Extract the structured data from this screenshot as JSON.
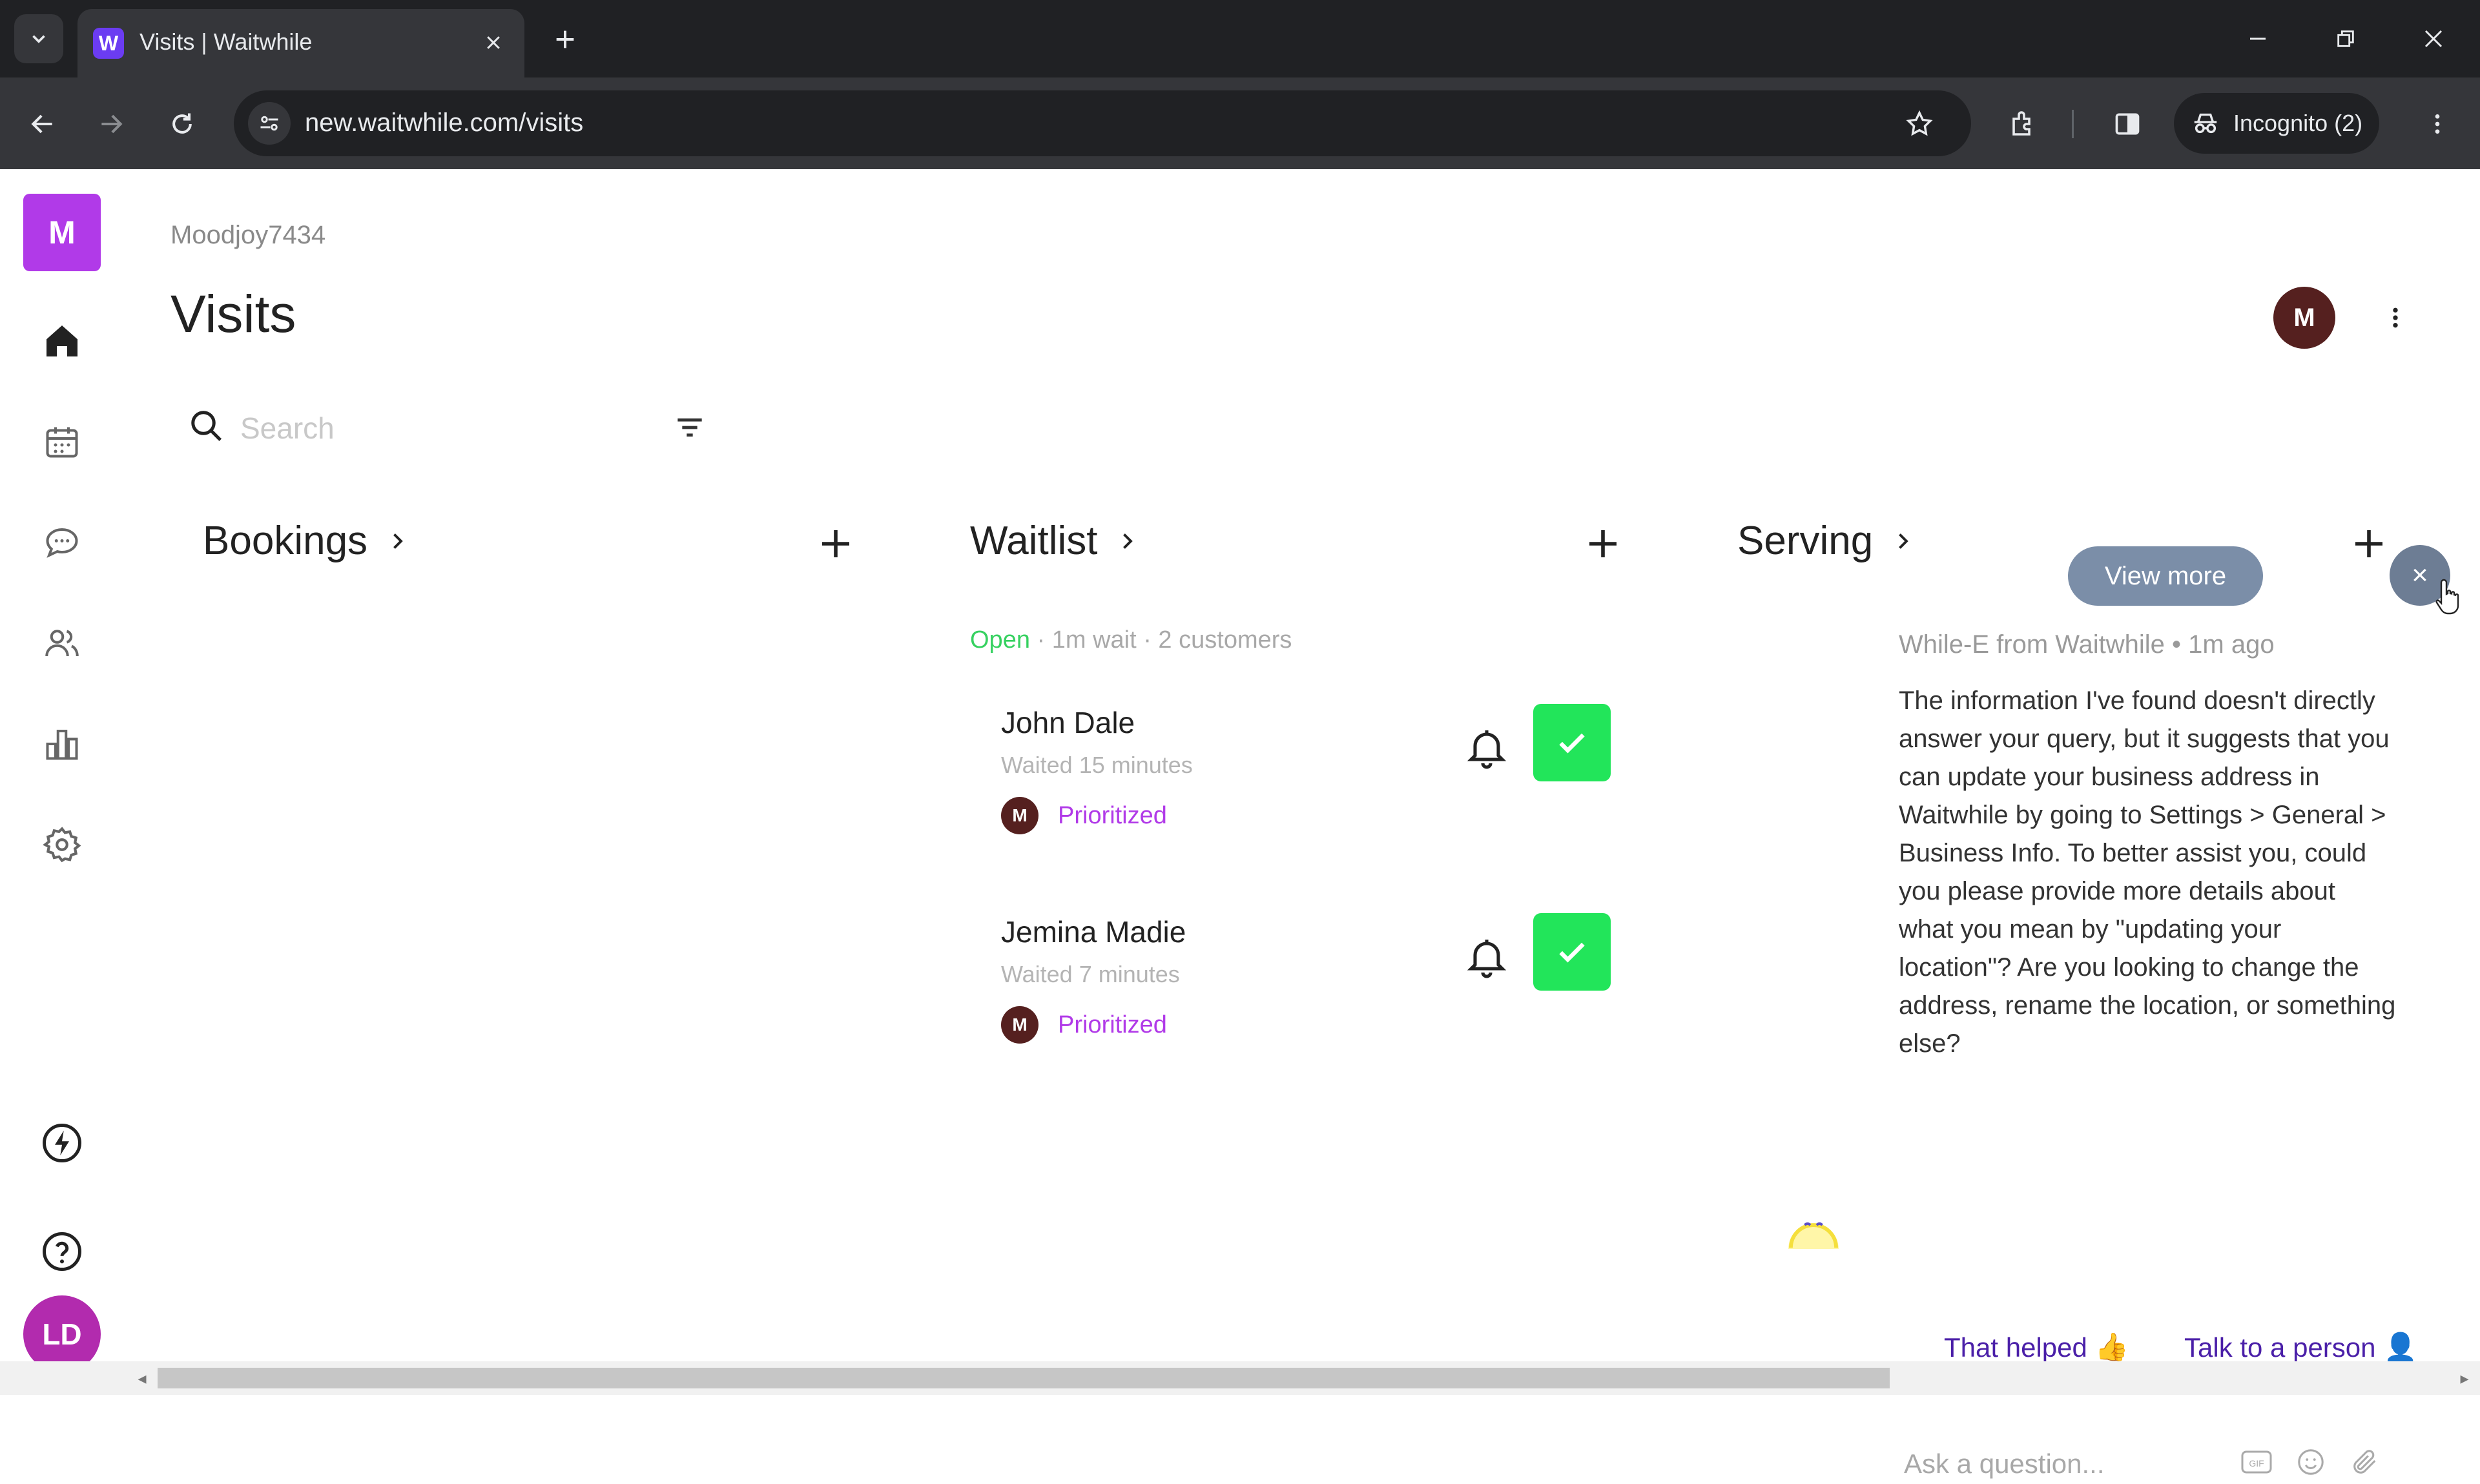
{
  "browser": {
    "tab_title": "Visits | Waitwhile",
    "tab_favicon": "W",
    "url": "new.waitwhile.com/visits",
    "incognito_label": "Incognito (2)",
    "icons": [
      "tab-search-icon",
      "close-icon",
      "plus-icon",
      "minimize-icon",
      "restore-icon",
      "close-window-icon",
      "back-icon",
      "forward-icon",
      "reload-icon",
      "site-info-icon",
      "star-icon",
      "extensions-icon",
      "side-panel-icon",
      "incognito-icon",
      "kebab-menu-icon"
    ]
  },
  "sidebar": {
    "logo": "M",
    "user_initials": "LD",
    "items": [
      {
        "name": "home-icon"
      },
      {
        "name": "calendar-icon"
      },
      {
        "name": "chat-icon"
      },
      {
        "name": "customers-icon"
      },
      {
        "name": "analytics-icon"
      },
      {
        "name": "settings-icon"
      },
      {
        "name": "lightning-icon"
      },
      {
        "name": "help-icon"
      }
    ]
  },
  "header": {
    "breadcrumb": "Moodjoy7434",
    "title": "Visits",
    "avatar": "M"
  },
  "search": {
    "placeholder": "Search"
  },
  "columns": {
    "bookings": {
      "title": "Bookings"
    },
    "waitlist": {
      "title": "Waitlist",
      "status_open": "Open",
      "status_rest": " · 1m wait · 2 customers",
      "cards": [
        {
          "name": "John Dale",
          "waited": "Waited 15 minutes",
          "tag_avatar": "M",
          "tag": "Prioritized"
        },
        {
          "name": "Jemina Madie",
          "waited": "Waited 7 minutes",
          "tag_avatar": "M",
          "tag": "Prioritized"
        }
      ]
    },
    "serving": {
      "title": "Serving"
    }
  },
  "chat": {
    "view_more": "View more",
    "close": "×",
    "meta": "While-E from Waitwhile • 1m ago",
    "message": "The information I've found doesn't directly answer your query, but it suggests that you can update your business address in Waitwhile by going to Settings > General > Business Info. To better assist you, could you please provide more details about what you mean by \"updating your location\"? Are you looking to change the address, rename the location, or something else?",
    "quick_replies": [
      {
        "label": "That helped",
        "emoji": "👍"
      },
      {
        "label": "Talk to a person",
        "emoji": "👤"
      }
    ],
    "input_placeholder": "Ask a question...",
    "gif_label": "GIF"
  },
  "colors": {
    "accent_purple": "#b13ae8",
    "success_green": "#22e55a",
    "open_green": "#36d160",
    "avatar_brown": "#55201f",
    "user_magenta": "#b22bae"
  }
}
